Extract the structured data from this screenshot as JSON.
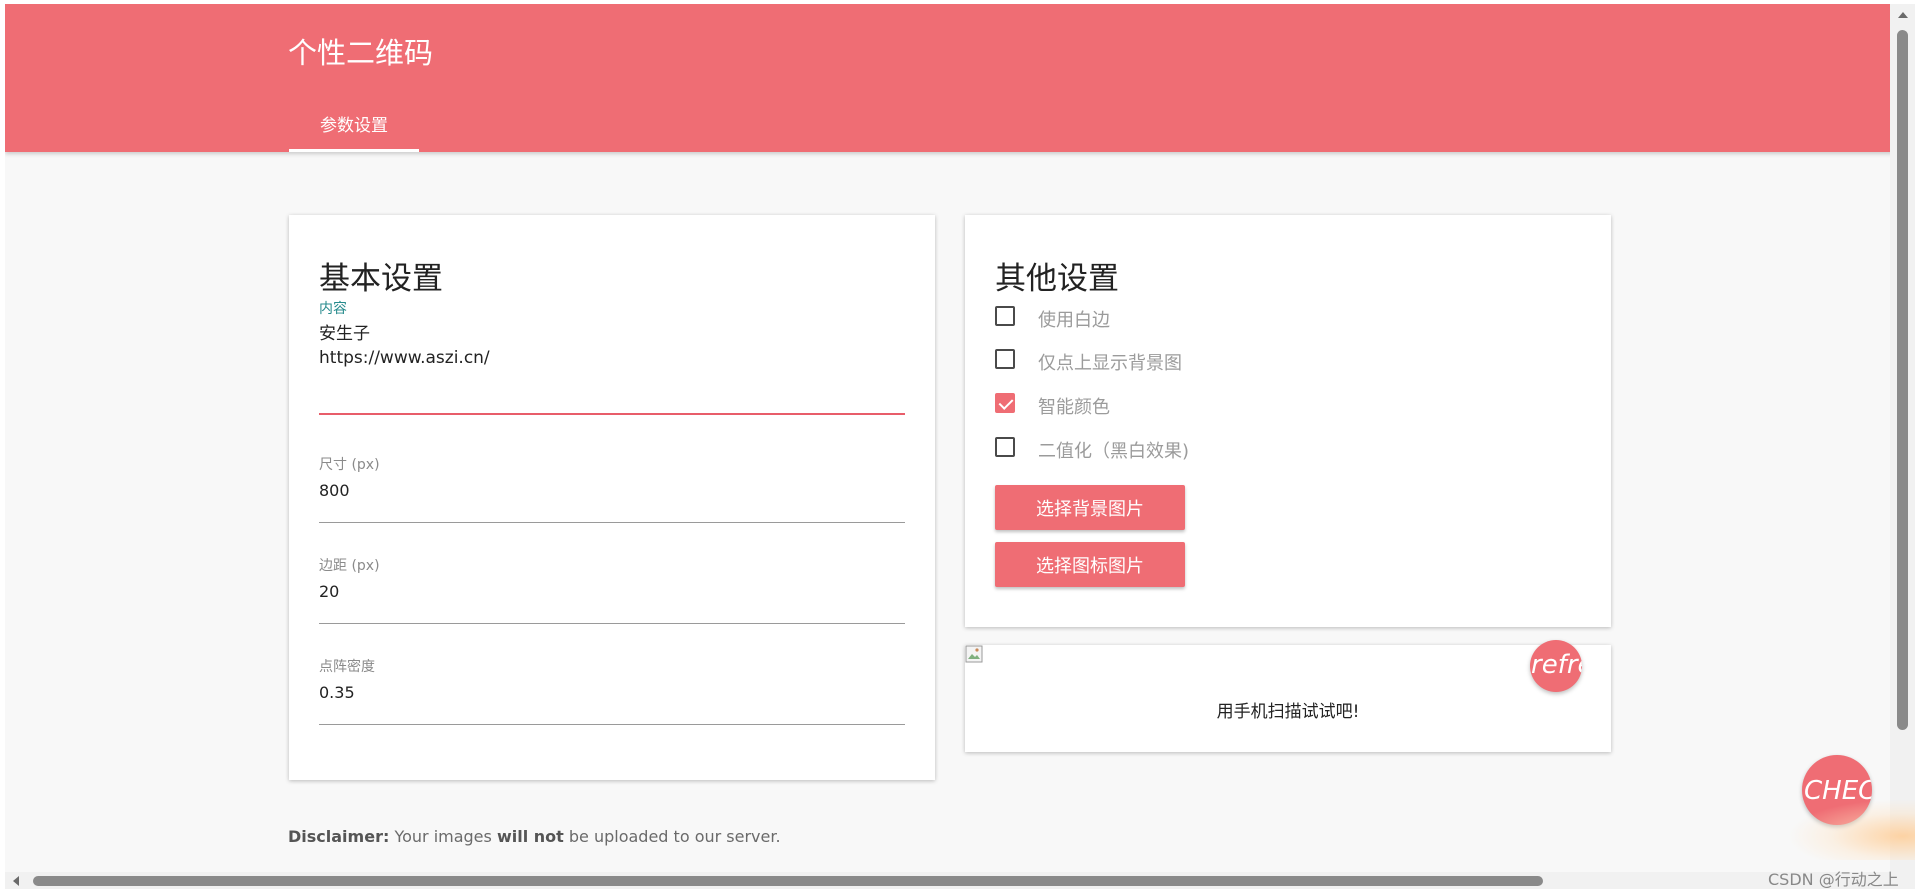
{
  "header": {
    "title": "个性二维码",
    "tab_label": "参数设置"
  },
  "basic": {
    "title": "基本设置",
    "content_label": "内容",
    "content_line1": "安生子",
    "content_line2": "https://www.aszi.cn/",
    "size_label": "尺寸 (px)",
    "size_value": "800",
    "margin_label": "边距 (px)",
    "margin_value": "20",
    "density_label": "点阵密度",
    "density_value": "0.35"
  },
  "other": {
    "title": "其他设置",
    "options": [
      {
        "label": "使用白边",
        "checked": false
      },
      {
        "label": "仅点上显示背景图",
        "checked": false
      },
      {
        "label": "智能颜色",
        "checked": true
      },
      {
        "label": "二值化（黑白效果)",
        "checked": false
      }
    ],
    "bg_button": "选择背景图片",
    "icon_button": "选择图标图片"
  },
  "preview": {
    "refresh_text": "refre",
    "caption": "用手机扫描试试吧!"
  },
  "check_fab_text": "CHEC",
  "disclaimer": {
    "lead": "Disclaimer:",
    "part1": " Your images ",
    "emphasis": "will not",
    "part2": " be uploaded to our server."
  },
  "watermark": "CSDN @行动之上",
  "colors": {
    "accent": "#ef6d74",
    "teal_label": "#268a8c",
    "background": "#f8f8f8"
  },
  "icons": {
    "checkbox_checked": "check-mark",
    "broken_image": "broken-image-icon"
  }
}
